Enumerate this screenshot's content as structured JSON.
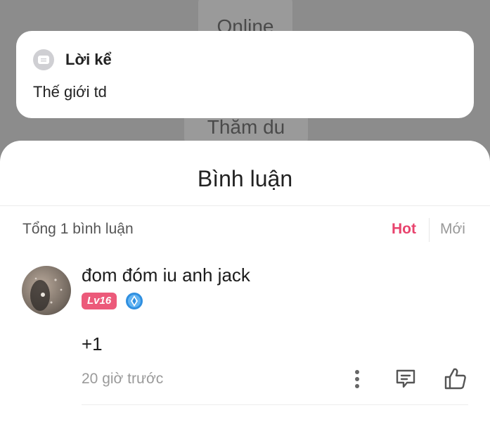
{
  "background": {
    "online_label": "Online",
    "visit_label": "Thăm du"
  },
  "story": {
    "icon": "message-icon",
    "title": "Lời kể",
    "text": "Thế giới td"
  },
  "comments_sheet": {
    "title": "Bình luận",
    "count_text": "Tổng 1 bình luận",
    "sort_hot": "Hot",
    "sort_new": "Mới",
    "accent_color": "#e8436d"
  },
  "comments": [
    {
      "username": "đom đóm iu anh jack",
      "level": "Lv16",
      "medal_icon": "diamond-medal-icon",
      "text": "+1",
      "time": "20 giờ trước",
      "actions": [
        "more-icon",
        "reply-icon",
        "like-icon"
      ]
    }
  ]
}
